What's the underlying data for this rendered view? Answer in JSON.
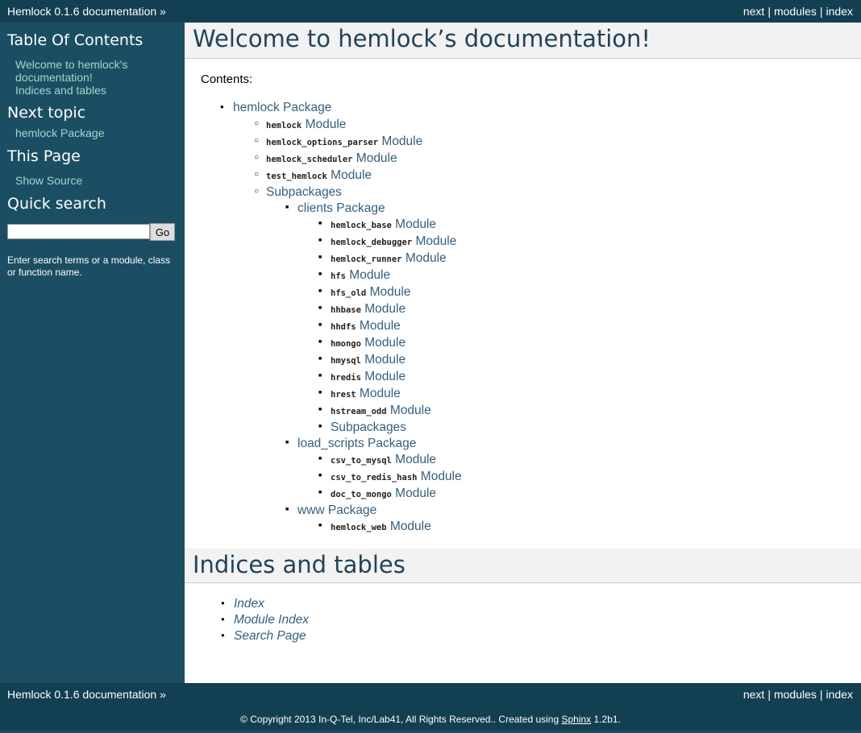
{
  "relbar": {
    "title": "Hemlock 0.1.6 documentation »",
    "links": [
      "next",
      "modules",
      "index"
    ],
    "separator": "|"
  },
  "sidebar": {
    "toc_heading": "Table Of Contents",
    "toc_links": [
      "Welcome to hemlock's documentation!",
      "Indices and tables"
    ],
    "next_heading": "Next topic",
    "next_link": "hemlock Package",
    "this_page_heading": "This Page",
    "show_source": "Show Source",
    "search_heading": "Quick search",
    "search_value": "",
    "go_label": "Go",
    "search_hint": "Enter search terms or a module, class or function name."
  },
  "main": {
    "title": "Welcome to hemlock’s documentation!",
    "contents_label": "Contents:",
    "toc": {
      "package": "hemlock Package",
      "modules": [
        {
          "code": "hemlock",
          "suffix": "Module"
        },
        {
          "code": "hemlock_options_parser",
          "suffix": "Module"
        },
        {
          "code": "hemlock_scheduler",
          "suffix": "Module"
        },
        {
          "code": "test_hemlock",
          "suffix": "Module"
        }
      ],
      "subpackages": "Subpackages",
      "clients": {
        "label": "clients Package",
        "modules": [
          {
            "code": "hemlock_base",
            "suffix": "Module"
          },
          {
            "code": "hemlock_debugger",
            "suffix": "Module"
          },
          {
            "code": "hemlock_runner",
            "suffix": "Module"
          },
          {
            "code": "hfs",
            "suffix": "Module"
          },
          {
            "code": "hfs_old",
            "suffix": "Module"
          },
          {
            "code": "hhbase",
            "suffix": "Module"
          },
          {
            "code": "hhdfs",
            "suffix": "Module"
          },
          {
            "code": "hmongo",
            "suffix": "Module"
          },
          {
            "code": "hmysql",
            "suffix": "Module"
          },
          {
            "code": "hredis",
            "suffix": "Module"
          },
          {
            "code": "hrest",
            "suffix": "Module"
          },
          {
            "code": "hstream_odd",
            "suffix": "Module"
          }
        ],
        "subpackages": "Subpackages"
      },
      "load_scripts": {
        "label": "load_scripts Package",
        "modules": [
          {
            "code": "csv_to_mysql",
            "suffix": "Module"
          },
          {
            "code": "csv_to_redis_hash",
            "suffix": "Module"
          },
          {
            "code": "doc_to_mongo",
            "suffix": "Module"
          }
        ]
      },
      "www": {
        "label": "www Package",
        "modules": [
          {
            "code": "hemlock_web",
            "suffix": "Module"
          }
        ]
      }
    },
    "indices_title": "Indices and tables",
    "indices": [
      "Index",
      "Module Index",
      "Search Page"
    ]
  },
  "footer": {
    "text_before": "© Copyright 2013 In-Q-Tel, Inc/Lab41, All Rights Reserved.. Created using ",
    "sphinx": "Sphinx",
    "text_after": " 1.2b1."
  }
}
